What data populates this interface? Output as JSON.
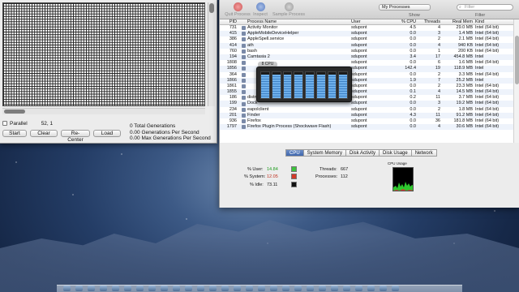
{
  "life": {
    "parallel_label": "Parallel",
    "coords": "52, 1",
    "buttons": {
      "start": "Start",
      "clear": "Clear",
      "recenter": "Re-Center",
      "load": "Load"
    },
    "stats": [
      "0 Total Generations",
      "0.00 Generations Per Second",
      "0.00 Max Generations Per Second"
    ]
  },
  "activity_monitor": {
    "toolbar": {
      "quit_process": "Quit Process",
      "inspect": "Inspect",
      "sample_process": "Sample Process",
      "show_selected": "My Processes",
      "show_label": "Show",
      "filter_placeholder": "Filter",
      "filter_label": "Filter"
    },
    "columns": [
      "PID",
      "Process Name",
      "User",
      "% CPU",
      "Threads",
      "Real Mem",
      "Kind"
    ],
    "rows": [
      {
        "pid": "731",
        "name": "Activity Monitor",
        "user": "sdupont",
        "cpu": "4.5",
        "threads": "4",
        "mem": "29.0 MB",
        "kind": "Intel (64 bit)"
      },
      {
        "pid": "415",
        "name": "AppleMobileDeviceHelper",
        "user": "sdupont",
        "cpu": "0.0",
        "threads": "3",
        "mem": "1.4 MB",
        "kind": "Intel (64 bit)"
      },
      {
        "pid": "386",
        "name": "AppleSpell.service",
        "user": "sdupont",
        "cpu": "0.0",
        "threads": "2",
        "mem": "2.1 MB",
        "kind": "Intel (64 bit)"
      },
      {
        "pid": "414",
        "name": "ath",
        "user": "sdupont",
        "cpu": "0.0",
        "threads": "4",
        "mem": "940 KB",
        "kind": "Intel (64 bit)"
      },
      {
        "pid": "760",
        "name": "bash",
        "user": "sdupont",
        "cpu": "0.0",
        "threads": "1",
        "mem": "200 KB",
        "kind": "Intel (64 bit)"
      },
      {
        "pid": "194",
        "name": "Camtasia 2",
        "user": "sdupont",
        "cpu": "3.4",
        "threads": "17",
        "mem": "454.8 MB",
        "kind": "Intel"
      },
      {
        "pid": "1808",
        "name": "",
        "user": "sdupont",
        "cpu": "0.0",
        "threads": "6",
        "mem": "1.6 MB",
        "kind": "Intel (64 bit)"
      },
      {
        "pid": "1856",
        "name": "",
        "user": "sdupont",
        "cpu": "142.4",
        "threads": "19",
        "mem": "118.9 MB",
        "kind": "Intel"
      },
      {
        "pid": "364",
        "name": "",
        "user": "sdupont",
        "cpu": "0.0",
        "threads": "2",
        "mem": "3.3 MB",
        "kind": "Intel (64 bit)"
      },
      {
        "pid": "1866",
        "name": "",
        "user": "sdupont",
        "cpu": "1.9",
        "threads": "7",
        "mem": "25.2 MB",
        "kind": "Intel"
      },
      {
        "pid": "1861",
        "name": "",
        "user": "sdupont",
        "cpu": "0.0",
        "threads": "2",
        "mem": "23.3 MB",
        "kind": "Intel (64 bit)"
      },
      {
        "pid": "1855",
        "name": "",
        "user": "sdupont",
        "cpu": "0.1",
        "threads": "4",
        "mem": "14.5 MB",
        "kind": "Intel (64 bit)"
      },
      {
        "pid": "186",
        "name": "distnoted",
        "user": "sdupont",
        "cpu": "0.2",
        "threads": "11",
        "mem": "3.7 MB",
        "kind": "Intel (64 bit)"
      },
      {
        "pid": "199",
        "name": "Dock",
        "user": "sdupont",
        "cpu": "0.0",
        "threads": "3",
        "mem": "19.2 MB",
        "kind": "Intel (64 bit)"
      },
      {
        "pid": "234",
        "name": "eapolclient",
        "user": "sdupont",
        "cpu": "0.0",
        "threads": "2",
        "mem": "1.8 MB",
        "kind": "Intel (64 bit)"
      },
      {
        "pid": "201",
        "name": "Finder",
        "user": "sdupont",
        "cpu": "4.3",
        "threads": "11",
        "mem": "91.2 MB",
        "kind": "Intel (64 bit)"
      },
      {
        "pid": "936",
        "name": "Firefox",
        "user": "sdupont",
        "cpu": "0.0",
        "threads": "36",
        "mem": "181.8 MB",
        "kind": "Intel (64 bit)"
      },
      {
        "pid": "1797",
        "name": "Firefox Plugin Process (Shockwave Flash)",
        "user": "sdupont",
        "cpu": "0.0",
        "threads": "4",
        "mem": "30.6 MB",
        "kind": "Intel (64 bit)"
      }
    ],
    "popup_badge": "8 CPU",
    "core_levels": [
      0.92,
      0.9,
      0.92,
      0.9,
      0.92,
      0.9,
      0.92,
      0.9
    ],
    "tabs": [
      "CPU",
      "System Memory",
      "Disk Activity",
      "Disk Usage",
      "Network"
    ],
    "cpu_panel": {
      "user_label": "% User:",
      "user_value": "14.84",
      "user_color": "#3cc33c",
      "system_label": "% System:",
      "system_value": "12.05",
      "system_color": "#d23a2a",
      "idle_label": "% Idle:",
      "idle_value": "73.11",
      "idle_color": "#111111",
      "threads_label": "Threads:",
      "threads_value": "667",
      "processes_label": "Processes:",
      "processes_value": "112",
      "graph_title": "CPU Usage"
    }
  }
}
